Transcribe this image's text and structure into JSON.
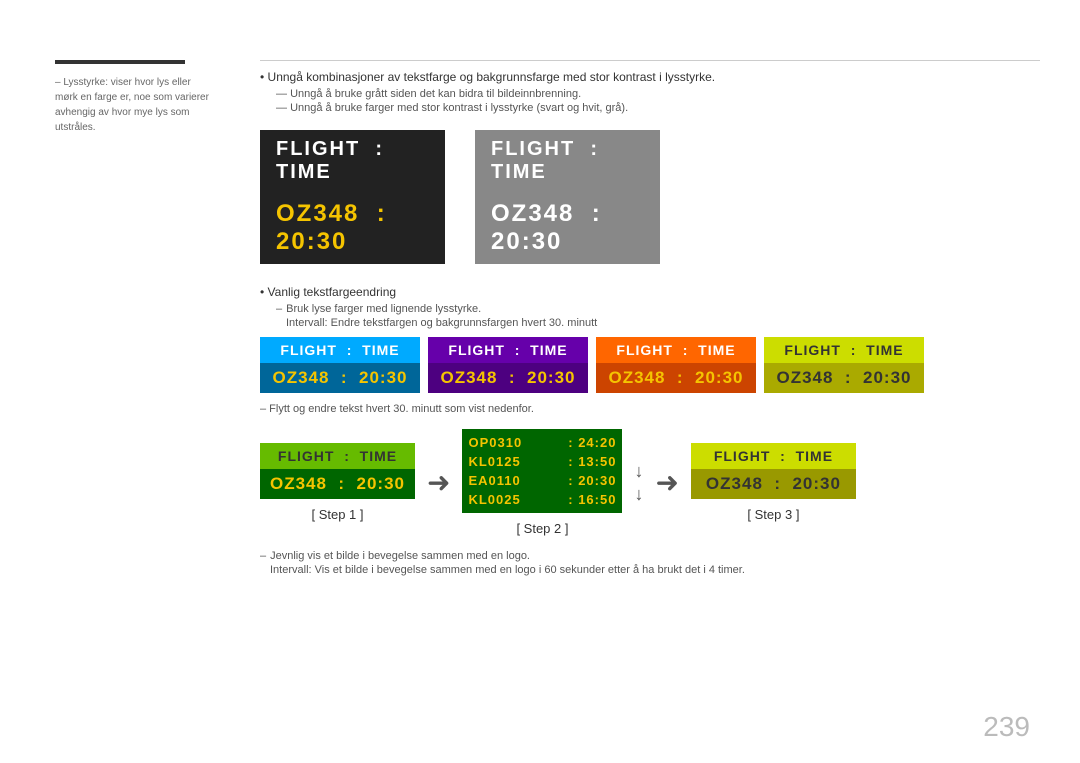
{
  "page": {
    "number": "239"
  },
  "sidebar": {
    "text": "– Lysstyrke: viser hvor lys eller mørk en farge er, noe som varierer avhengig av hvor mye lys som utstråles."
  },
  "main": {
    "bullets": [
      {
        "type": "bullet",
        "text": "Unngå kombinasjoner av tekstfarge og bakgrunnsfarge med stor kontrast i lysstyrke."
      },
      {
        "type": "dash",
        "text": "Unngå å bruke grått siden det kan bidra til bildeinnbrenning."
      },
      {
        "type": "dash",
        "text": "Unngå å bruke farger med stor kontrast i lysstyrke (svart og hvit, grå)."
      }
    ],
    "large_panels": [
      {
        "id": "dark",
        "top_label": "FLIGHT  :  TIME",
        "bottom_label": "OZ348  :  20:30",
        "style": "dark"
      },
      {
        "id": "gray",
        "top_label": "FLIGHT  :  TIME",
        "bottom_label": "OZ348  :  20:30",
        "style": "gray"
      }
    ],
    "regular_text_1": "Vanlig tekstfargeendring",
    "sub_bullets": [
      {
        "type": "dash",
        "text": "Bruk lyse farger med lignende lysstyrke."
      },
      {
        "type": "text",
        "text": "Intervall: Endre tekstfargen og bakgrunnsfargen hvert 30. minutt"
      }
    ],
    "small_panels": [
      {
        "top_label": "FLIGHT  :  TIME",
        "bottom_label": "OZ348  :  20:30",
        "style": "blue"
      },
      {
        "top_label": "FLIGHT  :  TIME",
        "bottom_label": "OZ348  :  20:30",
        "style": "purple"
      },
      {
        "top_label": "FLIGHT  :  TIME",
        "bottom_label": "OZ348  :  20:30",
        "style": "orange"
      },
      {
        "top_label": "FLIGHT  :  TIME",
        "bottom_label": "OZ348  :  20:30",
        "style": "yellow"
      }
    ],
    "move_text": "– Flytt og endre tekst hvert 30. minutt som vist nedenfor.",
    "steps": [
      {
        "id": "step1",
        "label": "[ Step 1 ]",
        "panel_top": "FLIGHT  :  TIME",
        "panel_bottom": "OZ348  :  20:30",
        "style": "green"
      },
      {
        "id": "step2",
        "label": "[ Step 2 ]",
        "rows": [
          "OP0310  :  24:20",
          "KL0125  :  13:50",
          "EA0110  :  20:30",
          "KL0025  :  16:50"
        ]
      },
      {
        "id": "step3",
        "label": "[ Step 3 ]",
        "panel_top": "FLIGHT  :  TIME",
        "panel_bottom": "OZ348  :  20:30",
        "style": "yellow"
      }
    ],
    "bottom_notes": [
      {
        "type": "dash",
        "text": "Jevnlig vis et bilde i bevegelse sammen med en logo."
      },
      {
        "type": "text",
        "text": "Intervall: Vis et bilde i bevegelse sammen med en logo i 60 sekunder etter å ha brukt det i 4 timer."
      }
    ]
  }
}
